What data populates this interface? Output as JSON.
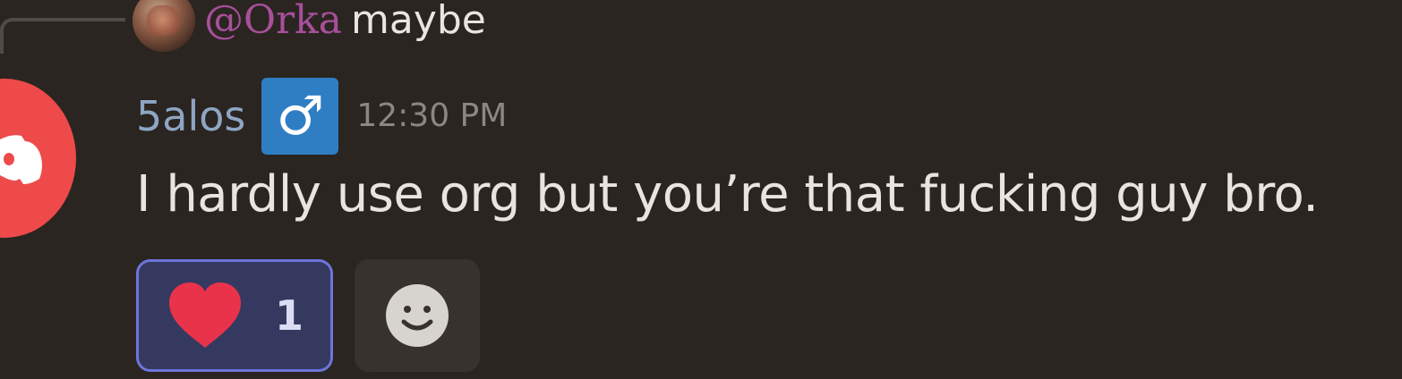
{
  "reply": {
    "mention": "@Orka",
    "text": "maybe"
  },
  "message": {
    "username": "5alos",
    "badge_symbol": "♂",
    "timestamp": "12:30 PM",
    "content": "I hardly use org but you’re that fucking guy bro."
  },
  "reactions": [
    {
      "emoji_icon": "heart-icon",
      "count": "1"
    }
  ],
  "colors": {
    "background": "#2a2520",
    "mention": "#a94f9c",
    "username": "#8ea5c4",
    "badge": "#2f7ec4",
    "avatar": "#ee4a4a",
    "reaction_border": "#6e74db",
    "heart": "#e8334a"
  }
}
